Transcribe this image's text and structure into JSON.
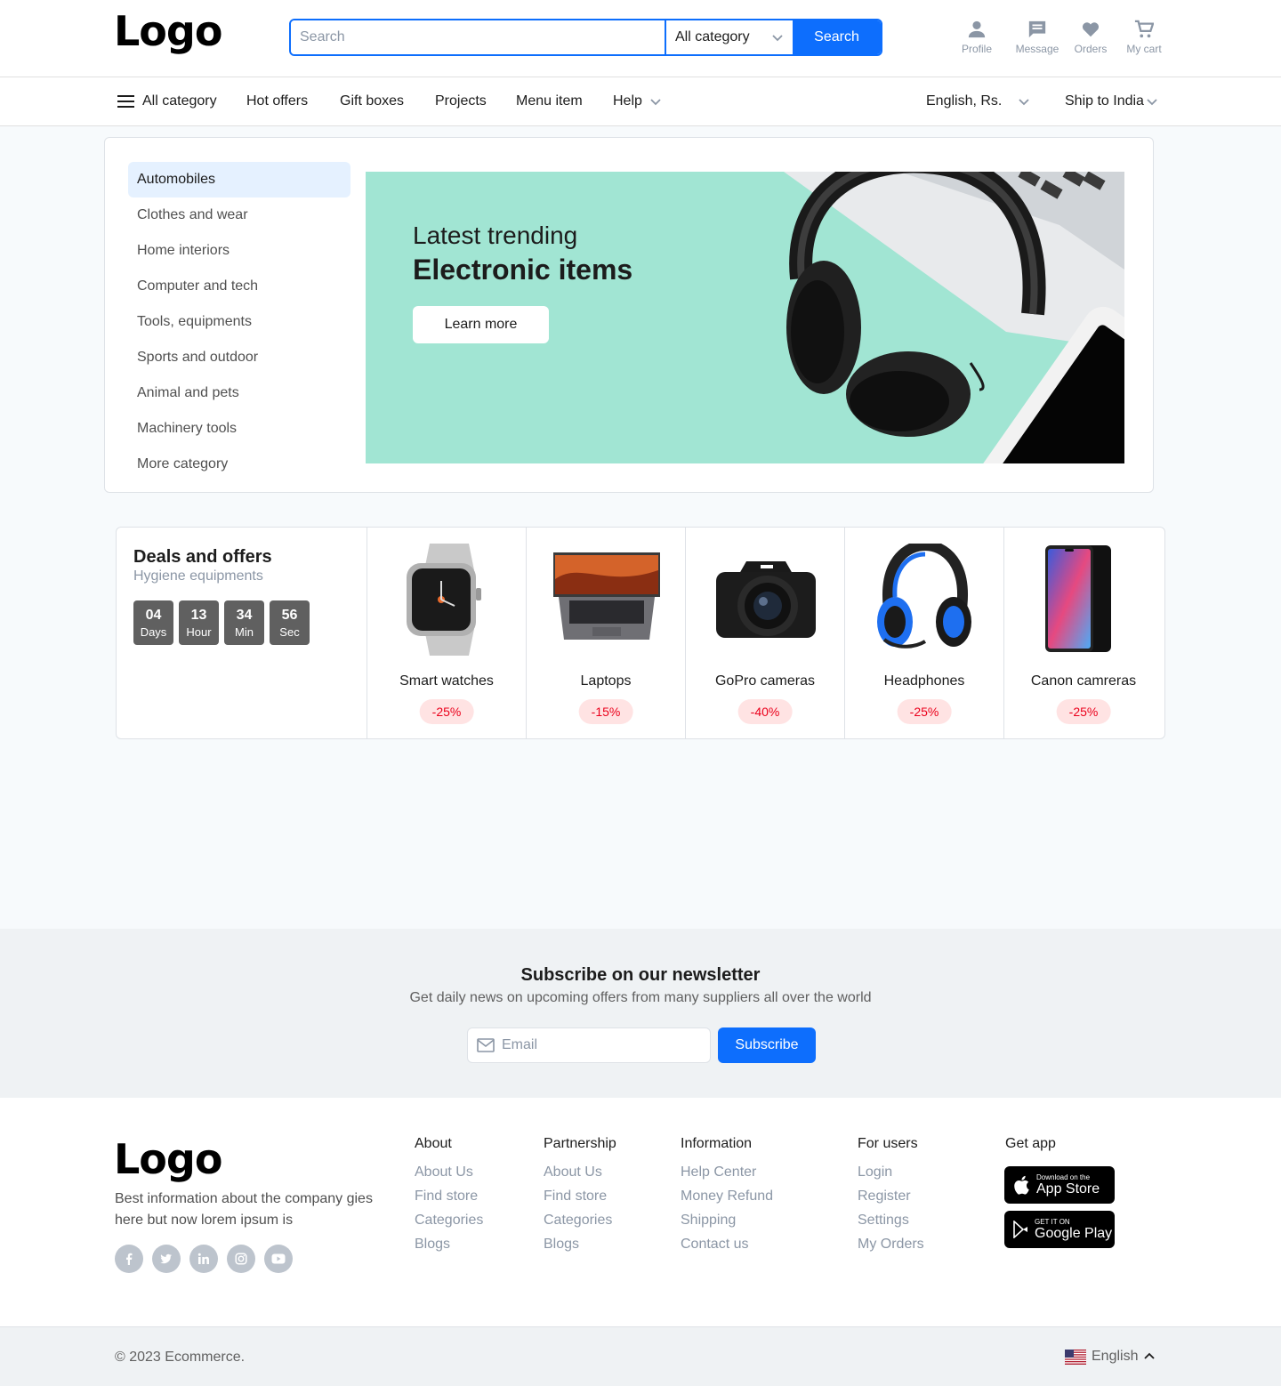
{
  "header": {
    "logo": "Logo",
    "search_placeholder": "Search",
    "search_category": "All category",
    "search_button": "Search",
    "icons": [
      {
        "label": "Profile",
        "icon": "person-icon"
      },
      {
        "label": "Message",
        "icon": "message-icon"
      },
      {
        "label": "Orders",
        "icon": "heart-icon"
      },
      {
        "label": "My cart",
        "icon": "cart-icon"
      }
    ]
  },
  "nav": {
    "all_category": "All category",
    "items": [
      "Hot offers",
      "Gift boxes",
      "Projects",
      "Menu item",
      "Help"
    ],
    "language": "English, Rs.",
    "ship_to": "Ship to India"
  },
  "categories": {
    "items": [
      "Automobiles",
      "Clothes and wear",
      "Home interiors",
      "Computer and tech",
      "Tools, equipments",
      "Sports and outdoor",
      "Animal and pets",
      "Machinery tools",
      "More category"
    ],
    "active": "Automobiles"
  },
  "banner": {
    "subtitle": "Latest trending",
    "title": "Electronic items",
    "button": "Learn more",
    "bg_color": "#a1e5d3"
  },
  "deals": {
    "title": "Deals and offers",
    "subtitle": "Hygiene equipments",
    "timer": [
      {
        "value": "04",
        "label": "Days"
      },
      {
        "value": "13",
        "label": "Hour"
      },
      {
        "value": "34",
        "label": "Min"
      },
      {
        "value": "56",
        "label": "Sec"
      }
    ],
    "items": [
      {
        "name": "Smart watches",
        "discount": "-25%"
      },
      {
        "name": "Laptops",
        "discount": "-15%"
      },
      {
        "name": "GoPro cameras",
        "discount": "-40%"
      },
      {
        "name": "Headphones",
        "discount": "-25%"
      },
      {
        "name": "Canon camreras",
        "discount": "-25%"
      }
    ]
  },
  "newsletter": {
    "title": "Subscribe on our newsletter",
    "subtitle": "Get daily news on upcoming offers from many suppliers all over the world",
    "email_placeholder": "Email",
    "button": "Subscribe"
  },
  "footer": {
    "logo": "Logo",
    "description": "Best information about the company gies here but now lorem ipsum is",
    "socials": [
      "facebook-icon",
      "twitter-icon",
      "linkedin-icon",
      "instagram-icon",
      "youtube-icon"
    ],
    "columns": [
      {
        "title": "About",
        "links": [
          "About Us",
          "Find store",
          "Categories",
          "Blogs"
        ]
      },
      {
        "title": "Partnership",
        "links": [
          "About Us",
          "Find store",
          "Categories",
          "Blogs"
        ]
      },
      {
        "title": "Information",
        "links": [
          "Help Center",
          "Money Refund",
          "Shipping",
          "Contact us"
        ]
      },
      {
        "title": "For users",
        "links": [
          "Login",
          "Register",
          "Settings",
          "My Orders"
        ]
      }
    ],
    "get_app": {
      "title": "Get app",
      "app_store_small": "Download on the",
      "app_store_big": "App Store",
      "google_small": "GET IT ON",
      "google_big": "Google Play"
    }
  },
  "bottom": {
    "copyright": "© 2023 Ecommerce.",
    "language": "English"
  },
  "colors": {
    "primary": "#0d6efd",
    "discount": "#eb001b",
    "discount_bg": "#ffe3e3"
  }
}
